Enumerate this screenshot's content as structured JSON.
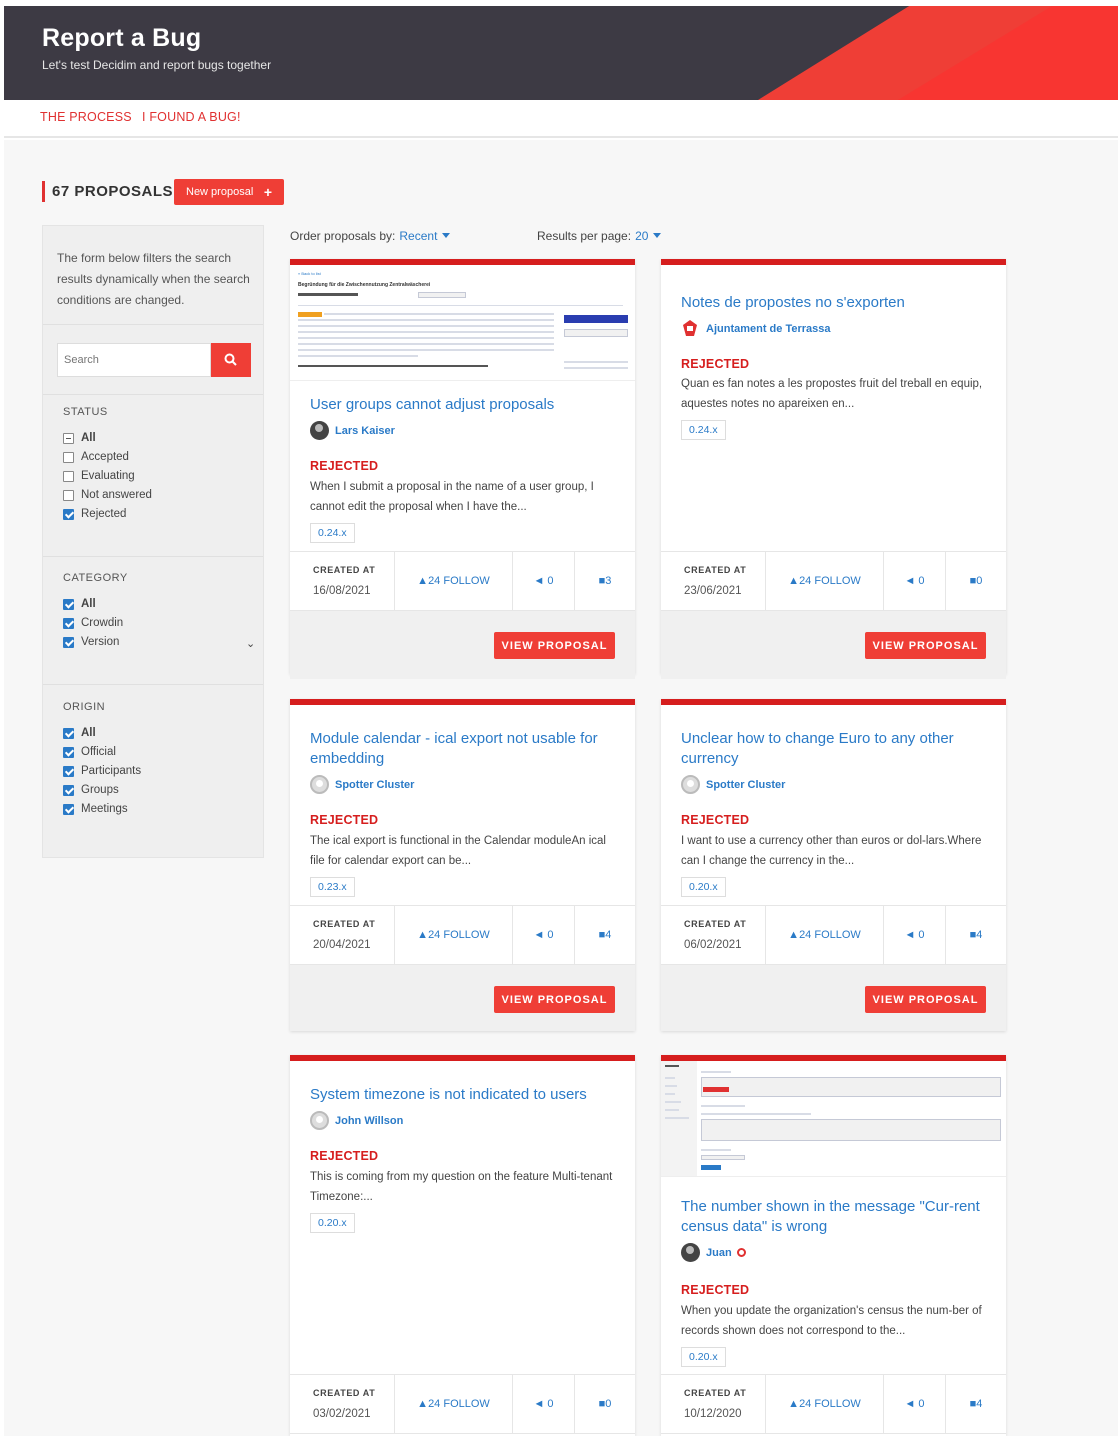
{
  "header": {
    "title": "Report a Bug",
    "subtitle": "Let's test Decidim and report bugs together"
  },
  "tabs": [
    {
      "label": "THE PROCESS"
    },
    {
      "label": "I FOUND A BUG!"
    }
  ],
  "listing": {
    "count_label": "67 PROPOSALS",
    "new_button": "New proposal",
    "order_label": "Order proposals by:",
    "order_value": "Recent",
    "per_page_label": "Results per page:",
    "per_page_value": "20"
  },
  "filters": {
    "intro": "The form below filters the search results dynamically when the search conditions are changed.",
    "search_placeholder": "Search",
    "status": {
      "title": "STATUS",
      "options": [
        {
          "label": "All",
          "state": "mixed"
        },
        {
          "label": "Accepted",
          "state": "off"
        },
        {
          "label": "Evaluating",
          "state": "off"
        },
        {
          "label": "Not answered",
          "state": "off"
        },
        {
          "label": "Rejected",
          "state": "on"
        }
      ]
    },
    "category": {
      "title": "CATEGORY",
      "options": [
        {
          "label": "All",
          "state": "on"
        },
        {
          "label": "Crowdin",
          "state": "on"
        },
        {
          "label": "Version",
          "state": "on"
        }
      ]
    },
    "origin": {
      "title": "ORIGIN",
      "options": [
        {
          "label": "All",
          "state": "on"
        },
        {
          "label": "Official",
          "state": "on"
        },
        {
          "label": "Participants",
          "state": "on"
        },
        {
          "label": "Groups",
          "state": "on"
        },
        {
          "label": "Meetings",
          "state": "on"
        }
      ]
    }
  },
  "meta_labels": {
    "created_at": "CREATED AT",
    "view": "VIEW PROPOSAL"
  },
  "cards": [
    {
      "title": "User groups cannot adjust proposals",
      "author": "Lars Kaiser",
      "status": "REJECTED",
      "description": "When I submit a proposal in the name of a user group, I cannot edit the proposal when I have the...",
      "tag": "0.24.x",
      "date": "16/08/2021",
      "follows": "24 FOLLOW",
      "endorsements": "0",
      "comments": "3"
    },
    {
      "title": "Notes de propostes no s'exporten",
      "author": "Ajuntament de Terrassa",
      "status": "REJECTED",
      "description": "Quan es fan notes a les propostes fruit del treball en equip, aquestes notes no apareixen en...",
      "tag": "0.24.x",
      "date": "23/06/2021",
      "follows": "24 FOLLOW",
      "endorsements": "0",
      "comments": "0"
    },
    {
      "title": "Module calendar - ical export not usable for embedding",
      "author": "Spotter Cluster",
      "status": "REJECTED",
      "description": "The ical export is functional in the Calendar moduleAn ical file for calendar export can be...",
      "tag": "0.23.x",
      "date": "20/04/2021",
      "follows": "24 FOLLOW",
      "endorsements": "0",
      "comments": "4"
    },
    {
      "title": "Unclear how to change Euro to any other currency",
      "author": "Spotter Cluster",
      "status": "REJECTED",
      "description": "I want to use a currency other than euros or dol-lars.Where can I change the currency in the...",
      "tag": "0.20.x",
      "date": "06/02/2021",
      "follows": "24 FOLLOW",
      "endorsements": "0",
      "comments": "4"
    },
    {
      "title": "System timezone is not indicated to users",
      "author": "John Willson",
      "status": "REJECTED",
      "description": "This is coming from my question on the feature Multi-tenant Timezone:...",
      "tag": "0.20.x",
      "date": "03/02/2021",
      "follows": "24 FOLLOW",
      "endorsements": "0",
      "comments": "0"
    },
    {
      "title": "The number shown in the message \"Cur-rent census data\" is wrong",
      "author": "Juan",
      "status": "REJECTED",
      "description": "When you update the organization's census the num-ber of records shown does not correspond to the...",
      "tag": "0.20.x",
      "date": "10/12/2020",
      "follows": "24 FOLLOW",
      "endorsements": "0",
      "comments": "4"
    }
  ],
  "thumb_text": {
    "back": "« Back to list",
    "heading": "Begründung für die Zwischennutzung Zentralwäscherei"
  }
}
